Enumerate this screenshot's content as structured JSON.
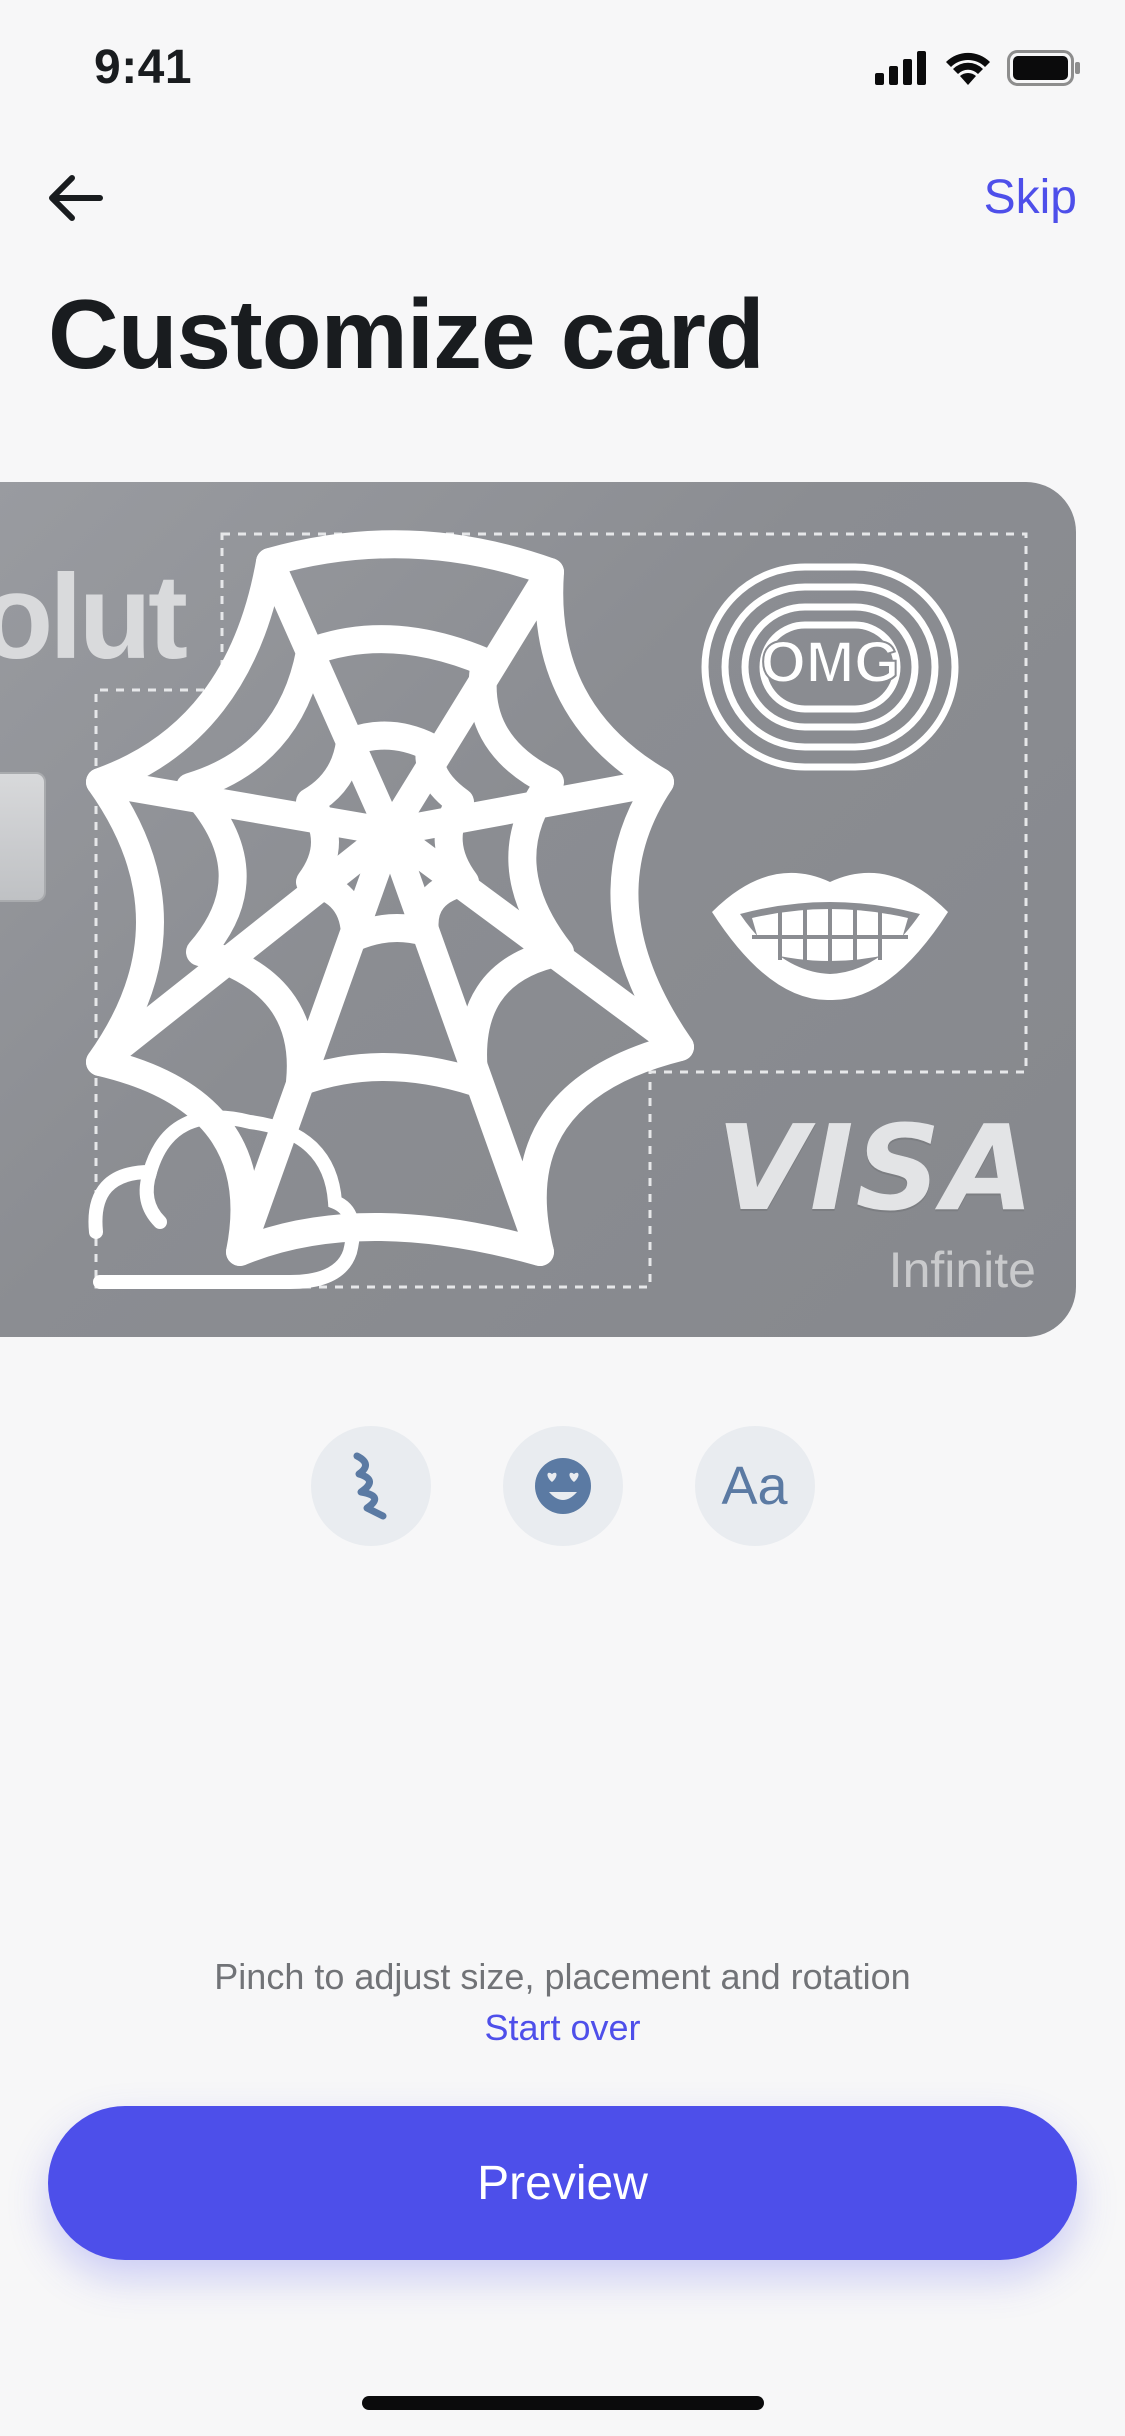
{
  "status_bar": {
    "time": "9:41",
    "icons": [
      "cellular-signal-icon",
      "wifi-icon",
      "battery-icon"
    ]
  },
  "nav": {
    "back_icon": "arrow-left-icon",
    "skip_label": "Skip"
  },
  "page": {
    "title": "Customize card"
  },
  "card": {
    "brand_text": "olut",
    "sticker_text": "OMG",
    "network": "VISA",
    "tier": "Infinite",
    "stickers": [
      "spiderweb-sticker",
      "omg-sticker",
      "lips-sticker",
      "cloud-sticker"
    ]
  },
  "tools": [
    {
      "name": "draw-tool",
      "icon": "squiggle-icon"
    },
    {
      "name": "sticker-tool",
      "icon": "heart-eyes-emoji-icon"
    },
    {
      "name": "text-tool",
      "label": "Aa"
    }
  ],
  "hint": {
    "text": "Pinch to adjust size, placement and rotation",
    "start_over_label": "Start over"
  },
  "actions": {
    "preview_label": "Preview"
  },
  "colors": {
    "accent": "#4e4fea",
    "background": "#f7f7f8",
    "card": "#8b8d92",
    "tool_bg": "#e9ecf0",
    "tool_icon": "#5b7aa3"
  }
}
